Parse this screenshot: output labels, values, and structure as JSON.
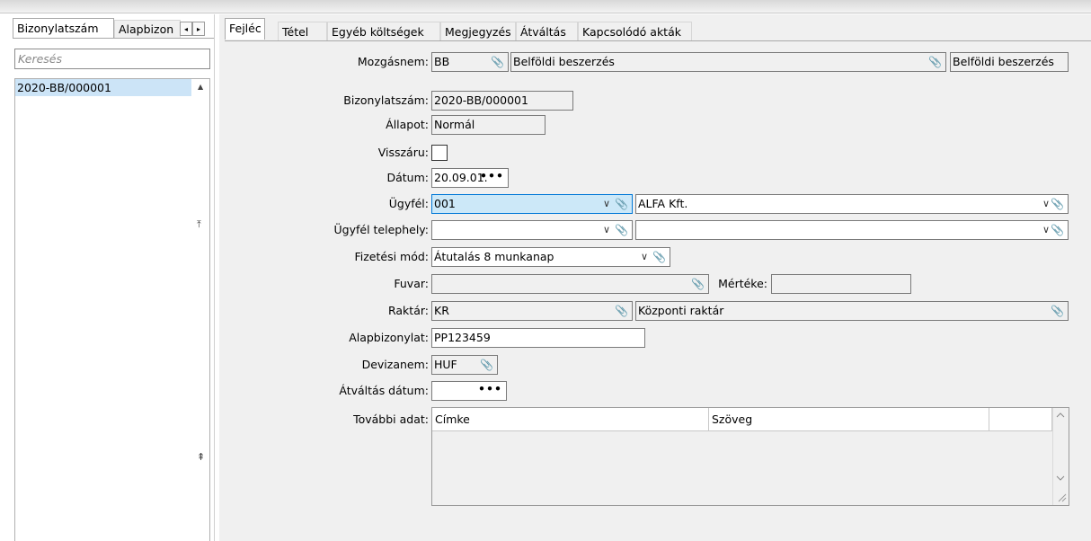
{
  "left_tabs": [
    "Bizonylatszám",
    "Alapbizon"
  ],
  "left_scroll": {
    "prev": "◂",
    "next": "▸"
  },
  "search": {
    "placeholder": "Keresés"
  },
  "list": {
    "items": [
      "2020-BB/000001"
    ]
  },
  "list_scroll": {
    "up": "▲",
    "top": "⤒",
    "pageup": "⇞"
  },
  "right_tabs": [
    "Fejléc",
    "Tétel",
    "Egyéb költségek",
    "Megjegyzés",
    "Átváltás",
    "Kapcsolódó akták"
  ],
  "form": {
    "mozgasnem": {
      "label": "Mozgásnem:",
      "code": "BB",
      "name": "Belföldi beszerzés",
      "name2": "Belföldi beszerzés"
    },
    "bizonylatszam": {
      "label": "Bizonylatszám:",
      "value": "2020-BB/000001"
    },
    "allapot": {
      "label": "Állapot:",
      "value": "Normál"
    },
    "visszaru": {
      "label": "Visszáru:",
      "checked": false
    },
    "datum": {
      "label": "Dátum:",
      "value": "20.09.01."
    },
    "ugyfel": {
      "label": "Ügyfél:",
      "code": "001",
      "name": "ALFA Kft."
    },
    "ugyfel_telephely": {
      "label": "Ügyfél telephely:",
      "code": "",
      "name": ""
    },
    "fizetesi_mod": {
      "label": "Fizetési mód:",
      "value": "Átutalás 8 munkanap"
    },
    "fuvar": {
      "label": "Fuvar:",
      "value": "",
      "merteke_label": "Mértéke:",
      "merteke": ""
    },
    "raktar": {
      "label": "Raktár:",
      "code": "KR",
      "name": "Központi raktár"
    },
    "alapbizonylat": {
      "label": "Alapbizonylat:",
      "value": "PP123459"
    },
    "devizanem": {
      "label": "Devizanem:",
      "value": "HUF"
    },
    "atvaltas_datum": {
      "label": "Átváltás dátum:",
      "value": ""
    },
    "tovabbi_adat": {
      "label": "További adat:",
      "columns": [
        "Címke",
        "Szöveg"
      ]
    }
  },
  "icons": {
    "clip": "📎",
    "dropdown": "∨",
    "ellipsis": "•••"
  },
  "colors": {
    "selection": "#cce4f7",
    "focus_border": "#0078d7",
    "readonly": "#f0f0f0"
  }
}
